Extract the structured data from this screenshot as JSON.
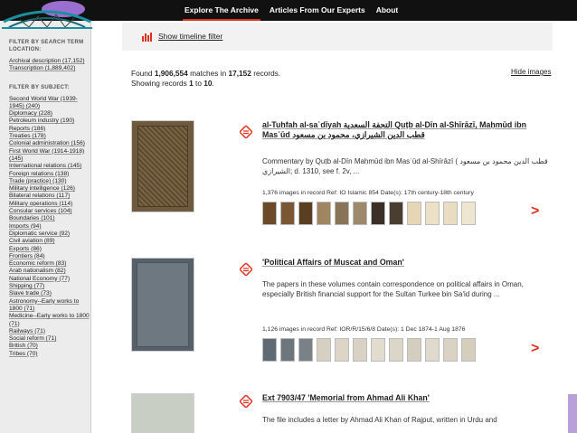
{
  "nav": {
    "items": [
      {
        "label": "Explore The Archive",
        "active": true
      },
      {
        "label": "Articles From Our Experts",
        "active": false
      },
      {
        "label": "About",
        "active": false
      }
    ]
  },
  "sidebar": {
    "search_heading": "FILTER BY SEARCH TERM LOCATION:",
    "search_items": [
      "Archival description (17,152)",
      "Transcription (1,889,402)"
    ],
    "subject_heading": "FILTER BY SUBJECT:",
    "subject_items": [
      "Second World War (1939-1945) (240)",
      "Diplomacy (228)",
      "Petroleum industry (190)",
      "Reports (186)",
      "Treaties (178)",
      "Colonial administration (156)",
      "First World War (1914-1918) (145)",
      "International relations (145)",
      "Foreign relations (138)",
      "Trade (practice) (130)",
      "Military intelligence (126)",
      "Bilateral relations (117)",
      "Military operations (114)",
      "Consular services (104)",
      "Boundaries (101)",
      "Imports (94)",
      "Diplomatic service (92)",
      "Civil aviation (89)",
      "Exports (86)",
      "Frontiers (84)",
      "Economic reform (83)",
      "Arab nationalism (82)",
      "National Economy (77)",
      "Shipping (77)",
      "Slave trade (73)",
      "Astronomy--Early works to 1800 (71)",
      "Medicine--Early works to 1800 (71)",
      "Railways (71)",
      "Social reform (71)",
      "British (70)",
      "Tribes (70)"
    ]
  },
  "timeline": {
    "label": "Show timeline filter"
  },
  "results": {
    "found_prefix": "Found ",
    "found_count": "1,906,554",
    "found_mid": " matches in ",
    "found_records": "17,152",
    "found_suffix": " records.",
    "showing_prefix": "Showing records ",
    "showing_from": "1",
    "showing_to_word": " to ",
    "showing_to": "10",
    "showing_suffix": ".",
    "hide_images": "Hide images"
  },
  "records": [
    {
      "title": "al-Tuḥfah al-saʿdīyah التحفة السعدية Quṭb al-Dīn al-Shīrāzī, Maḥmūd ibn Masʿūd قطب الدين الشيرازي، محمود بن مسعود",
      "description": "Commentary by Quṭb al-Dīn Maḥmūd ibn Masʿūd al-Shīrāzī ( قطب الدين محمود بن مسعود الشيرازي; d. 1310, see f. 2v, ...",
      "meta": "1,376 images in record  Ref: IO Islamic 854  Date(s): 17th century-18th century",
      "strip_colors": [
        "#6b4a2a",
        "#7a5632",
        "#5a3e22",
        "#a08660",
        "#8a7458",
        "#9c8a6a",
        "#3a3028",
        "#4a3e30",
        "#e6d6b6",
        "#ece0c6",
        "#e8dcc2",
        "#efe6d2"
      ]
    },
    {
      "title": "'Political Affairs of Muscat and Oman'",
      "description": "The papers in these volumes contain correspondence on political affairs in Oman, especially British financial support for the Sultan Turkee bin Sa'id during ...",
      "meta": "1,126 images in record  Ref: IOR/R/15/6/8  Date(s): 1 Dec 1874-1 Aug 1876",
      "strip_colors": [
        "#5f6a72",
        "#6d767c",
        "#7a8288",
        "#d6d0c2",
        "#ddd6c6",
        "#d8d2c4",
        "#e2dcce",
        "#dcd6c8",
        "#d4cebe",
        "#e0dacc",
        "#dad2c2",
        "#d6cebc"
      ]
    },
    {
      "title": "Ext 7903/47 'Memorial from Ahmad Ali Khan'",
      "description": "The file includes a letter by Ahmad Ali Khan of Rajput, written in Urdu and"
    }
  ],
  "colors": {
    "accent": "#e0301e",
    "topbar": "#111111",
    "sidebar": "#ececec"
  }
}
